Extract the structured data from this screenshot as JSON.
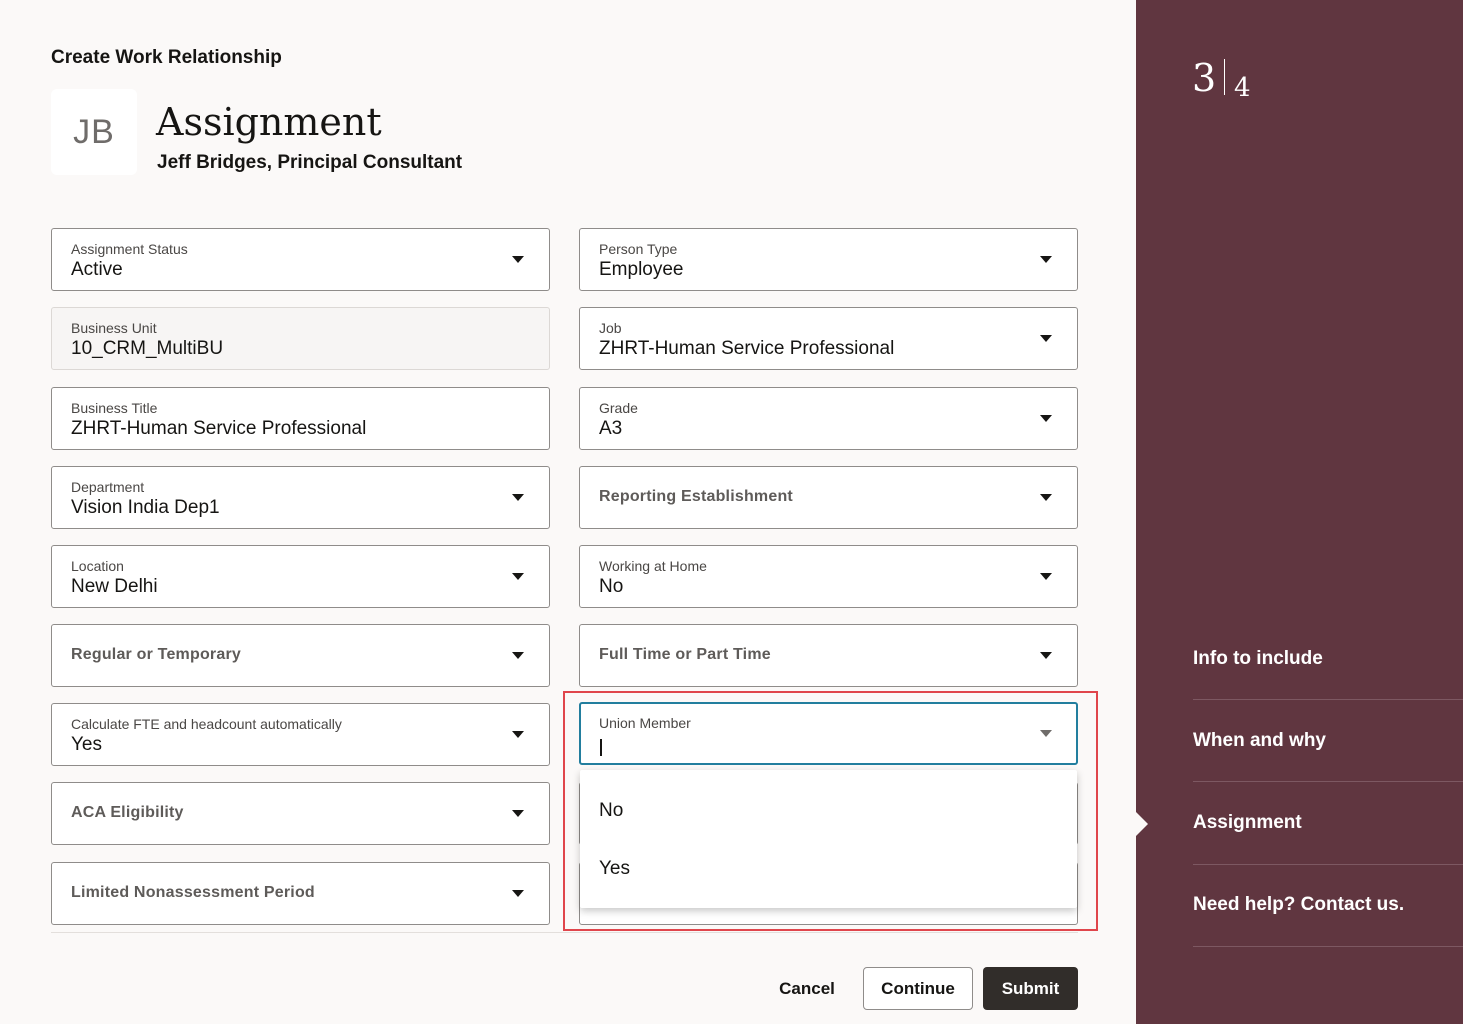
{
  "header": {
    "caption": "Create Work Relationship",
    "avatar_initials": "JB",
    "title": "Assignment",
    "subtitle": "Jeff Bridges, Principal Consultant"
  },
  "fields": {
    "assignment_status": {
      "label": "Assignment Status",
      "value": "Active"
    },
    "person_type": {
      "label": "Person Type",
      "value": "Employee"
    },
    "business_unit": {
      "label": "Business Unit",
      "value": "10_CRM_MultiBU"
    },
    "job": {
      "label": "Job",
      "value": "ZHRT-Human Service Professional"
    },
    "business_title": {
      "label": "Business Title",
      "value": "ZHRT-Human Service Professional"
    },
    "grade": {
      "label": "Grade",
      "value": "A3"
    },
    "department": {
      "label": "Department",
      "value": "Vision India Dep1"
    },
    "reporting_establishment": {
      "label": "Reporting Establishment"
    },
    "location": {
      "label": "Location",
      "value": "New Delhi"
    },
    "working_at_home": {
      "label": "Working at Home",
      "value": "No"
    },
    "regular_or_temporary": {
      "label": "Regular or Temporary"
    },
    "full_time_or_part_time": {
      "label": "Full Time or Part Time"
    },
    "calculate_fte": {
      "label": "Calculate FTE and headcount automatically",
      "value": "Yes"
    },
    "union_member": {
      "label": "Union Member",
      "options": [
        "No",
        "Yes"
      ]
    },
    "aca_eligibility": {
      "label": "ACA Eligibility"
    },
    "limited_nonassessment_period": {
      "label": "Limited Nonassessment Period"
    }
  },
  "actions": {
    "cancel": "Cancel",
    "continue": "Continue",
    "submit": "Submit"
  },
  "sidebar": {
    "step_current": "3",
    "step_total": "4",
    "items": [
      {
        "label": "Info to include"
      },
      {
        "label": "When and why"
      },
      {
        "label": "Assignment",
        "active": true
      },
      {
        "label": "Need help? Contact us."
      }
    ]
  },
  "colors": {
    "sidebar_bg": "#603640",
    "focus_border": "#227e9e",
    "highlight_border": "#e0464c",
    "primary_button": "#312d2a"
  }
}
